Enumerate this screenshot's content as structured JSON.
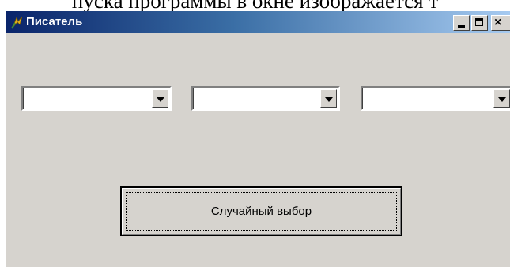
{
  "document": {
    "text_above": "пуска программы в окне изображается т"
  },
  "window": {
    "title": "Писатель",
    "caption_buttons": {
      "minimize": "minimize-icon",
      "maximize": "maximize-icon",
      "close": "×"
    }
  },
  "combos": [
    {
      "value": "",
      "arrow_icon": "dropdown-arrow-icon"
    },
    {
      "value": "",
      "arrow_icon": "dropdown-arrow-icon"
    },
    {
      "value": "",
      "arrow_icon": "dropdown-arrow-icon"
    }
  ],
  "button": {
    "label": "Случайный выбор"
  },
  "colors": {
    "window_face": "#d6d3ce",
    "titlebar_start": "#0a246a",
    "titlebar_end": "#a6caf0"
  }
}
